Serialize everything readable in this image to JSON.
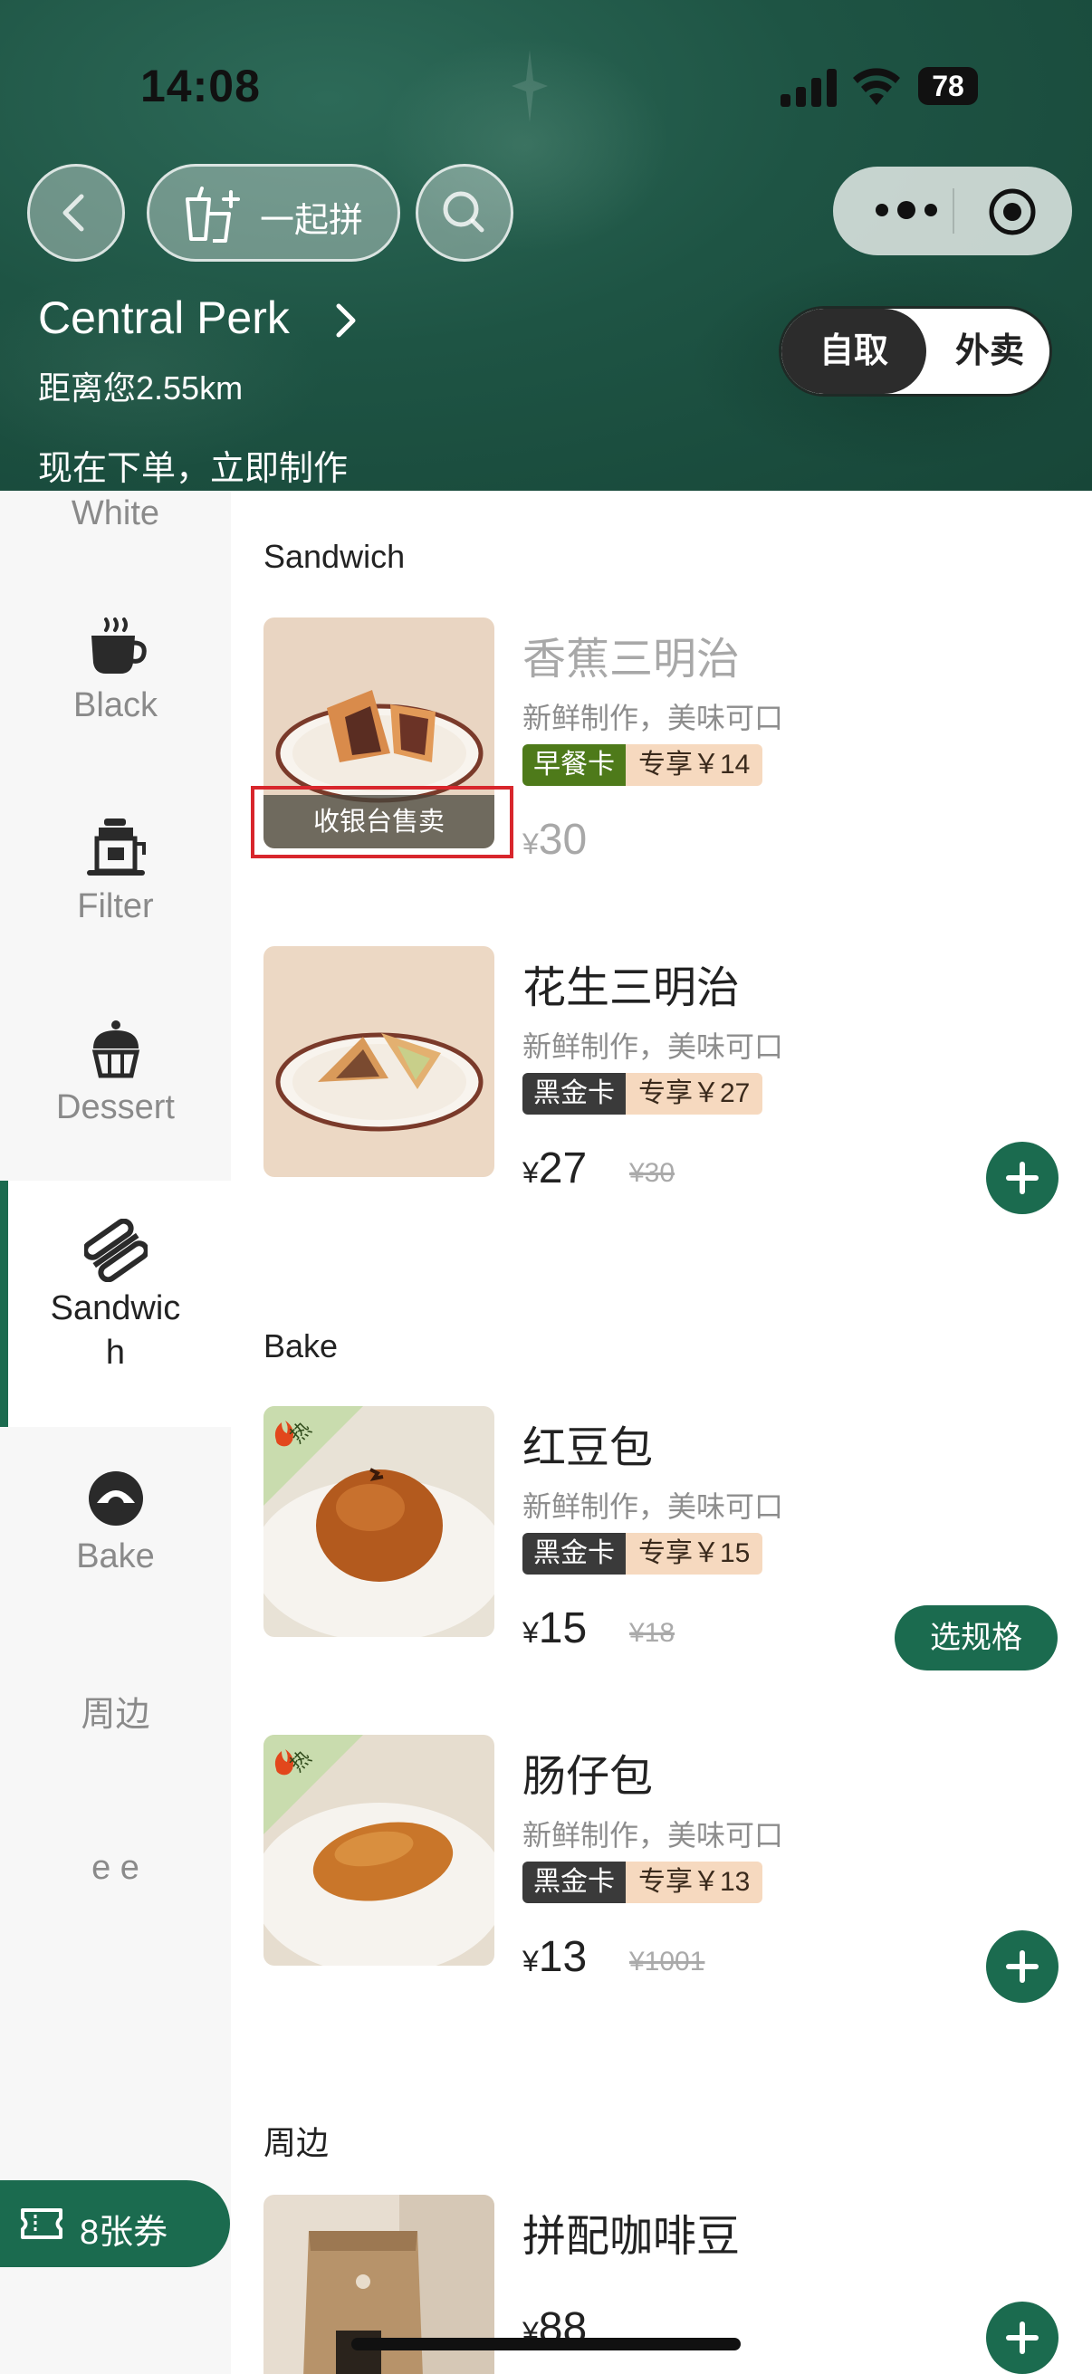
{
  "status_bar": {
    "time": "14:08",
    "battery": "78"
  },
  "header": {
    "group_order_label": "一起拼",
    "store_name": "Central Perk",
    "distance": "距离您2.55km",
    "order_hint": "现在下单，立即制作",
    "mode_pickup": "自取",
    "mode_delivery": "外卖",
    "selected_mode": "自取"
  },
  "sidebar": {
    "items": [
      {
        "label": "White",
        "icon": ""
      },
      {
        "label": "Black",
        "icon": "coffee-cup-icon"
      },
      {
        "label": "Filter",
        "icon": "filter-kettle-icon"
      },
      {
        "label": "Dessert",
        "icon": "cake-icon"
      },
      {
        "label": "Sandwich",
        "label_lines": [
          "Sandwic",
          "h"
        ],
        "icon": "sandwich-icon",
        "active": true
      },
      {
        "label": "Bake",
        "icon": "bake-icon"
      },
      {
        "label": "周边",
        "icon": ""
      },
      {
        "label": "e e",
        "icon": ""
      }
    ],
    "coupon_label": "8张券"
  },
  "sections": {
    "sandwich": "Sandwich",
    "bake": "Bake",
    "merch": "周边"
  },
  "products": [
    {
      "name": "香蕉三明治",
      "desc": "新鲜制作，美味可口",
      "card": "早餐卡",
      "deal": "专享￥14",
      "price": "30",
      "currency": "¥",
      "overlay": "收银台售卖",
      "available": false
    },
    {
      "name": "花生三明治",
      "desc": "新鲜制作，美味可口",
      "card": "黑金卡",
      "deal": "专享￥27",
      "price": "27",
      "currency": "¥",
      "original_price": "¥30"
    },
    {
      "name": "红豆包",
      "desc": "新鲜制作，美味可口",
      "card": "黑金卡",
      "deal": "专享￥15",
      "price": "15",
      "currency": "¥",
      "original_price": "¥18",
      "hot_badge": "热",
      "action": "选规格"
    },
    {
      "name": "肠仔包",
      "desc": "新鲜制作，美味可口",
      "card": "黑金卡",
      "deal": "专享￥13",
      "price": "13",
      "currency": "¥",
      "original_price": "¥1001",
      "hot_badge": "热"
    },
    {
      "name": "拼配咖啡豆",
      "price": "88",
      "currency": "¥"
    }
  ],
  "colors": {
    "brand_green": "#1b6b4f",
    "breakfast_card": "#4e7a1a",
    "black_card": "#3a3a3a",
    "deal_bg": "#f6d9bf",
    "highlight": "#d8262c"
  }
}
